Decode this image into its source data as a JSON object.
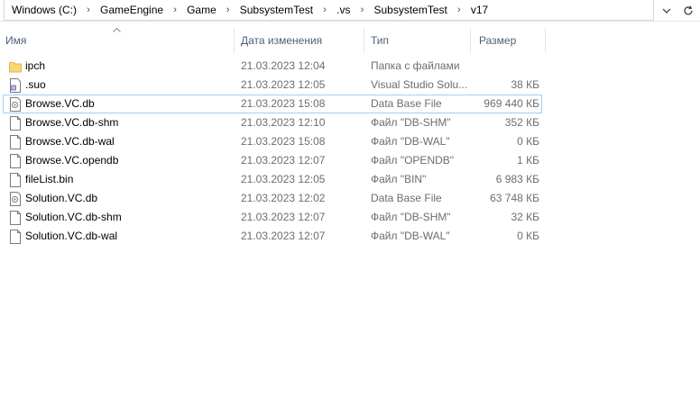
{
  "breadcrumb": [
    "Windows (C:)",
    "GameEngine",
    "Game",
    "SubsystemTest",
    ".vs",
    "SubsystemTest",
    "v17"
  ],
  "address_icons": {
    "dropdown": "chevron-down-icon",
    "refresh": "refresh-icon"
  },
  "columns": {
    "name": "Имя",
    "date": "Дата изменения",
    "type": "Тип",
    "size": "Размер"
  },
  "files": [
    {
      "name": "ipch",
      "date": "21.03.2023 12:04",
      "type": "Папка с файлами",
      "size": "",
      "icon": "folder-icon"
    },
    {
      "name": ".suo",
      "date": "21.03.2023 12:05",
      "type": "Visual Studio Solu...",
      "size": "38 КБ",
      "icon": "suo-file-icon"
    },
    {
      "name": "Browse.VC.db",
      "date": "21.03.2023 15:08",
      "type": "Data Base File",
      "size": "969 440 КБ",
      "icon": "db-file-icon",
      "selected": true
    },
    {
      "name": "Browse.VC.db-shm",
      "date": "21.03.2023 12:10",
      "type": "Файл \"DB-SHM\"",
      "size": "352 КБ",
      "icon": "file-icon"
    },
    {
      "name": "Browse.VC.db-wal",
      "date": "21.03.2023 15:08",
      "type": "Файл \"DB-WAL\"",
      "size": "0 КБ",
      "icon": "file-icon"
    },
    {
      "name": "Browse.VC.opendb",
      "date": "21.03.2023 12:07",
      "type": "Файл \"OPENDB\"",
      "size": "1 КБ",
      "icon": "file-icon"
    },
    {
      "name": "fileList.bin",
      "date": "21.03.2023 12:05",
      "type": "Файл \"BIN\"",
      "size": "6 983 КБ",
      "icon": "file-icon"
    },
    {
      "name": "Solution.VC.db",
      "date": "21.03.2023 12:02",
      "type": "Data Base File",
      "size": "63 748 КБ",
      "icon": "db-file-icon"
    },
    {
      "name": "Solution.VC.db-shm",
      "date": "21.03.2023 12:07",
      "type": "Файл \"DB-SHM\"",
      "size": "32 КБ",
      "icon": "file-icon"
    },
    {
      "name": "Solution.VC.db-wal",
      "date": "21.03.2023 12:07",
      "type": "Файл \"DB-WAL\"",
      "size": "0 КБ",
      "icon": "file-icon"
    }
  ]
}
